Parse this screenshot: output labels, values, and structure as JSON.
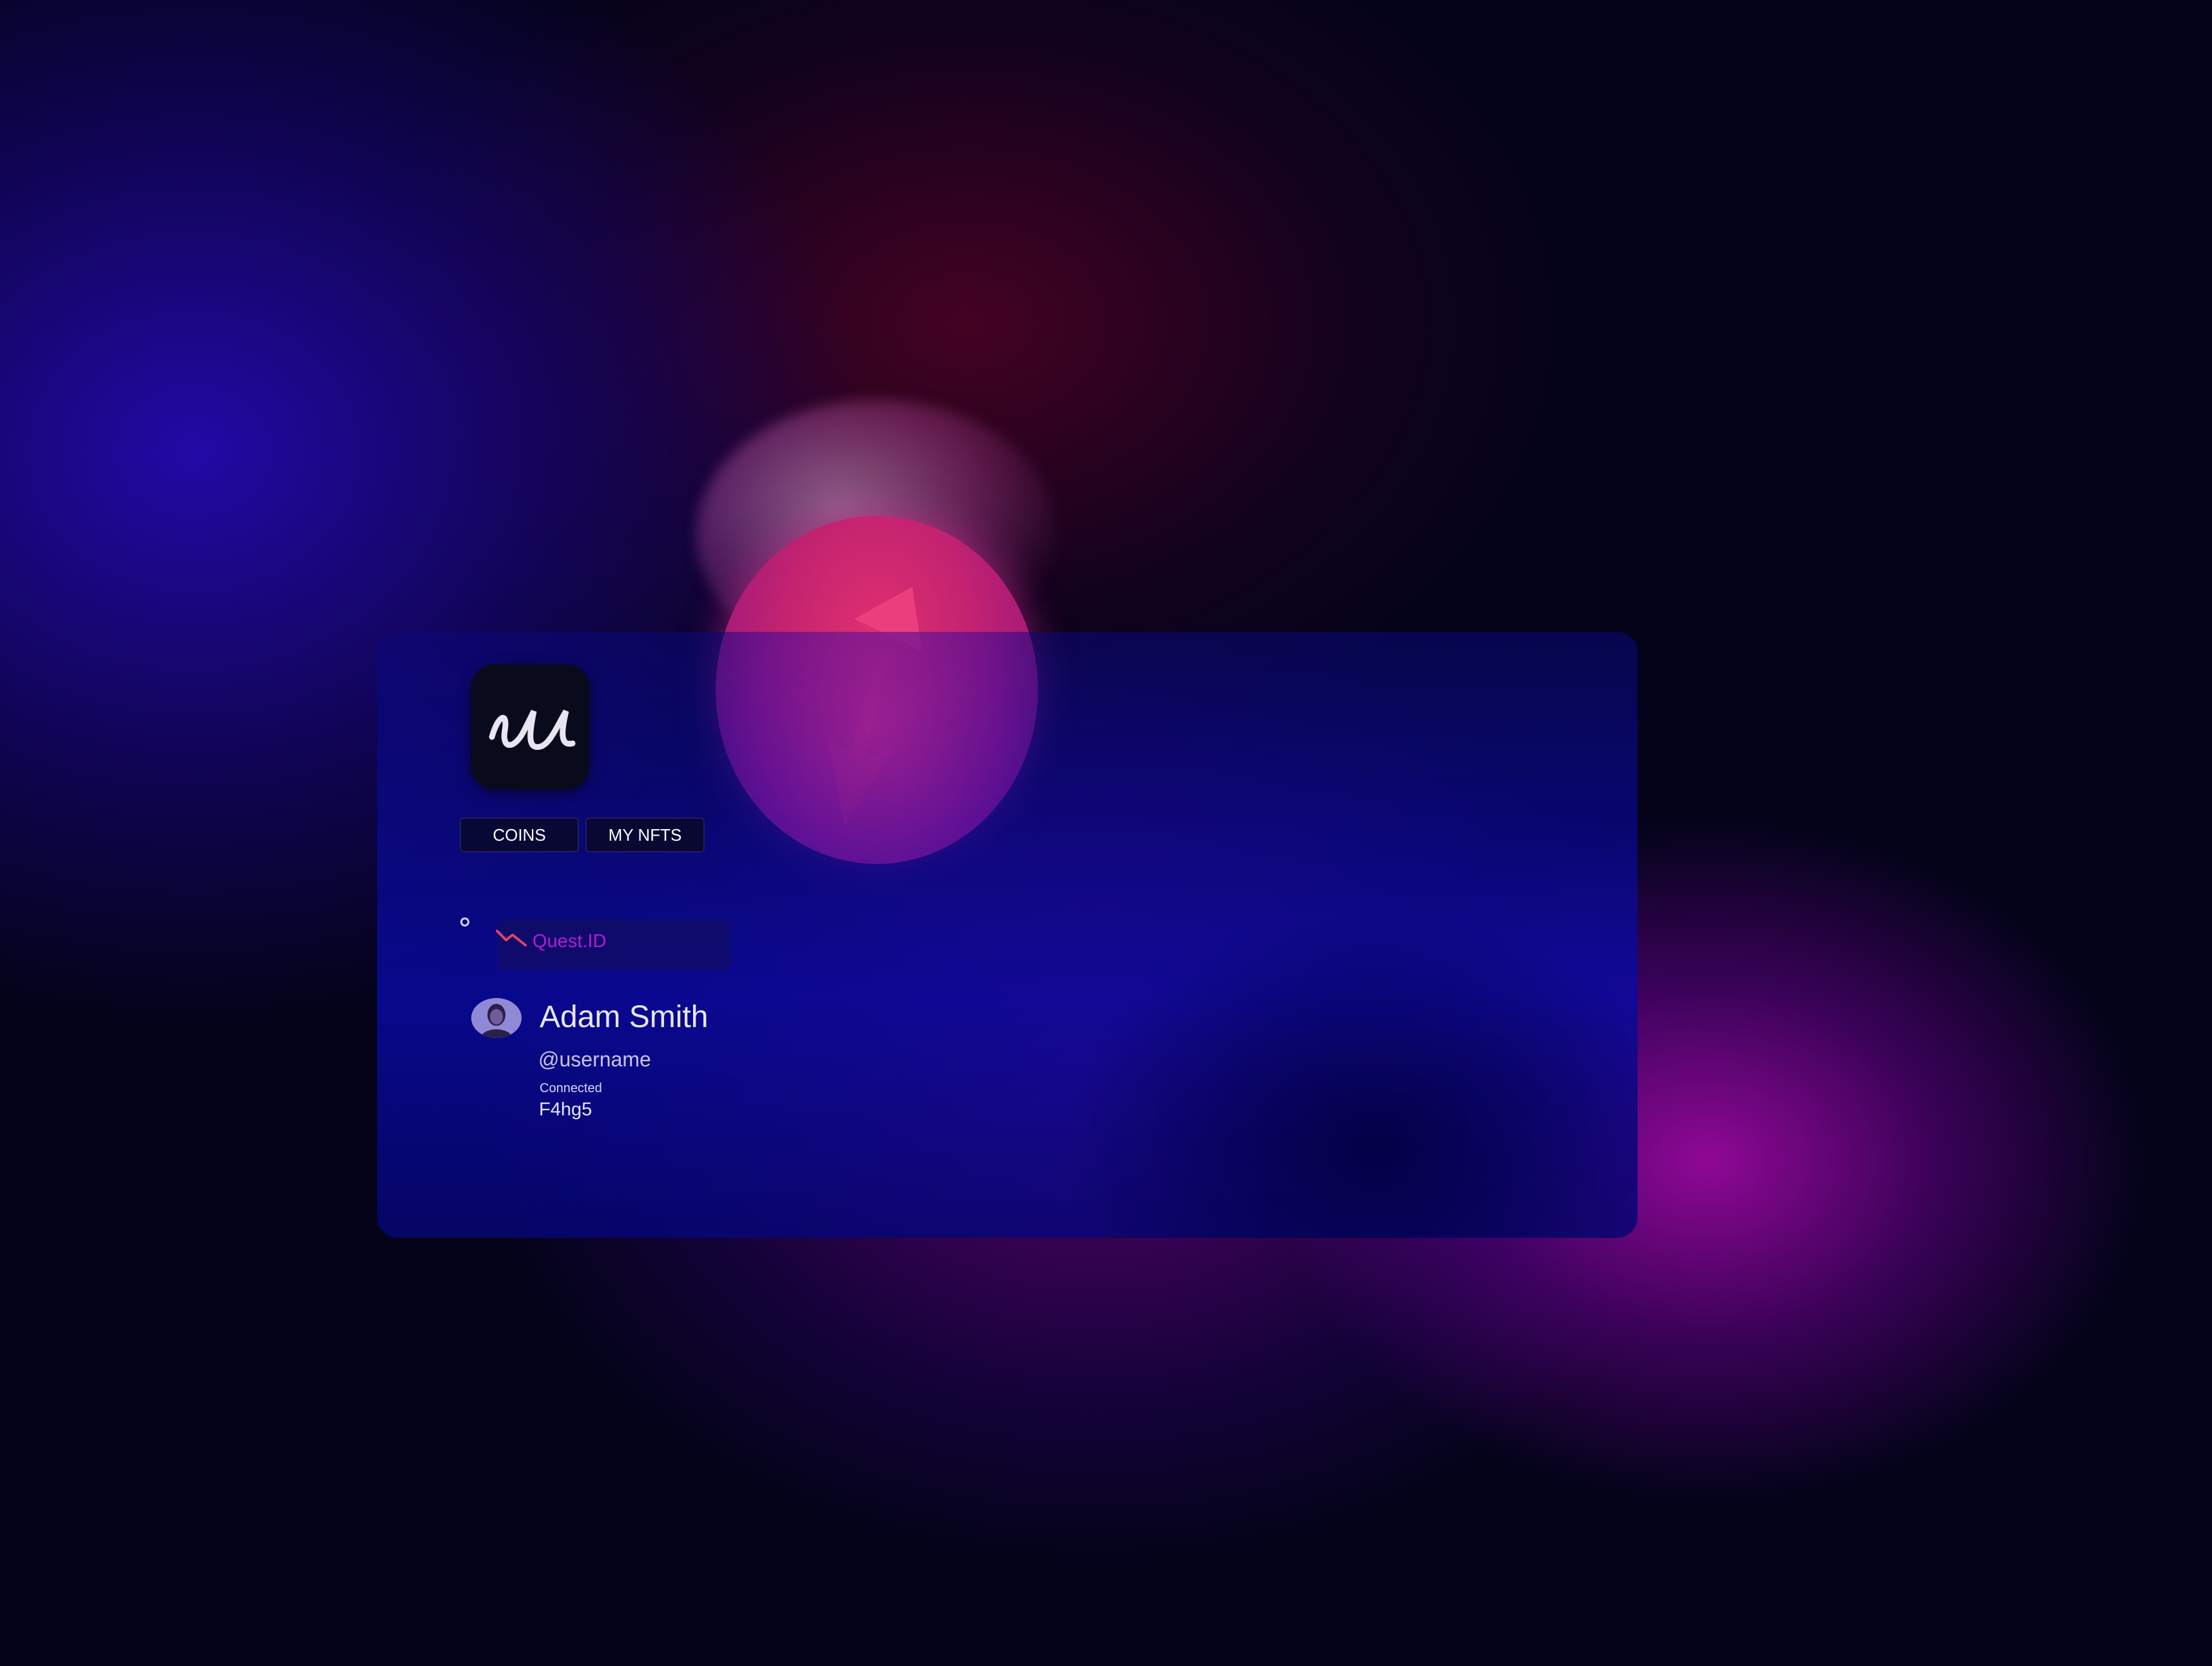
{
  "tabs": [
    {
      "label": "COINS"
    },
    {
      "label": "MY NFTS"
    }
  ],
  "quest": {
    "label": "Quest.ID",
    "icon": "trend-down-icon"
  },
  "profile": {
    "name": "Adam Smith",
    "handle": "@username",
    "status": "Connected",
    "code": "F4hg5"
  },
  "icons": {
    "logo": "script-u-logo",
    "coin": "swap-arrows-coin-icon"
  },
  "colors": {
    "accent": "#b01dd0",
    "coin": "#c42370",
    "card": "#0a0aa0",
    "background": "#04031a"
  }
}
